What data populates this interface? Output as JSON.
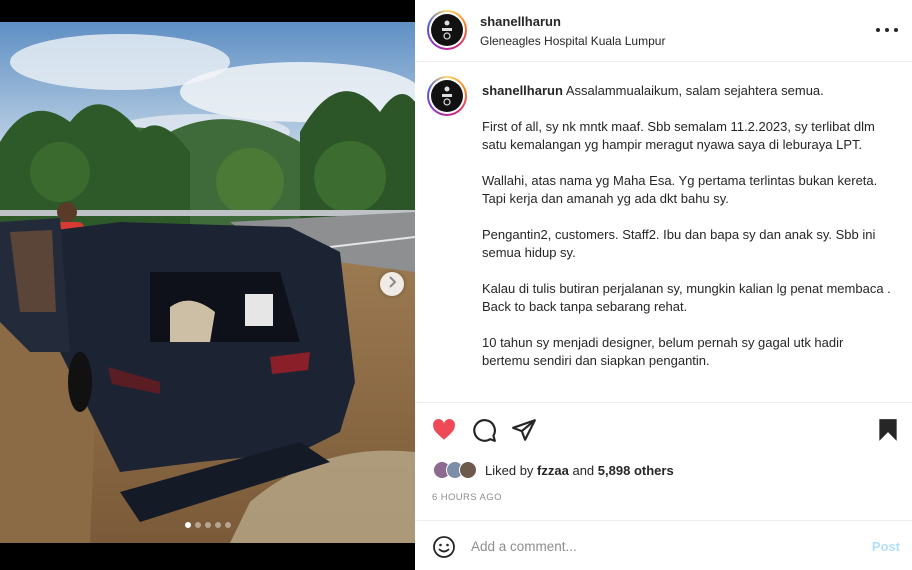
{
  "post": {
    "username": "shanellharun",
    "location": "Gleneagles Hospital Kuala Lumpur",
    "media": {
      "total_slides": 5,
      "active_slide": 1
    },
    "caption": {
      "username": "shanellharun",
      "paragraphs": [
        "Assalammualaikum, salam sejahtera semua.",
        "First of all, sy nk mntk maaf. Sbb semalam 11.2.2023, sy terlibat dlm satu kemalangan yg hampir meragut nyawa saya di leburaya LPT.",
        "Wallahi, atas nama yg Maha Esa. Yg pertama terlintas bukan kereta. Tapi kerja dan amanah yg ada dkt bahu sy.",
        "Pengantin2, customers. Staff2. Ibu dan bapa sy dan anak sy. Sbb ini semua hidup sy.",
        "Kalau di tulis butiran perjalanan sy, mungkin kalian lg penat membaca . Back to back tanpa sebarang rehat.",
        "10 tahun sy menjadi designer, belum pernah sy gagal utk hadir bertemu sendiri dan siapkan pengantin."
      ]
    },
    "likes": {
      "prefix": "Liked by",
      "user": "fzzaa",
      "connector": "and",
      "others": "5,898 others"
    },
    "timestamp": "6 HOURS AGO",
    "comment": {
      "placeholder": "Add a comment...",
      "post_label": "Post"
    },
    "colors": {
      "heart": "#ed4956",
      "post_disabled": "#b2dffc",
      "muted": "#8e8e8e"
    }
  }
}
